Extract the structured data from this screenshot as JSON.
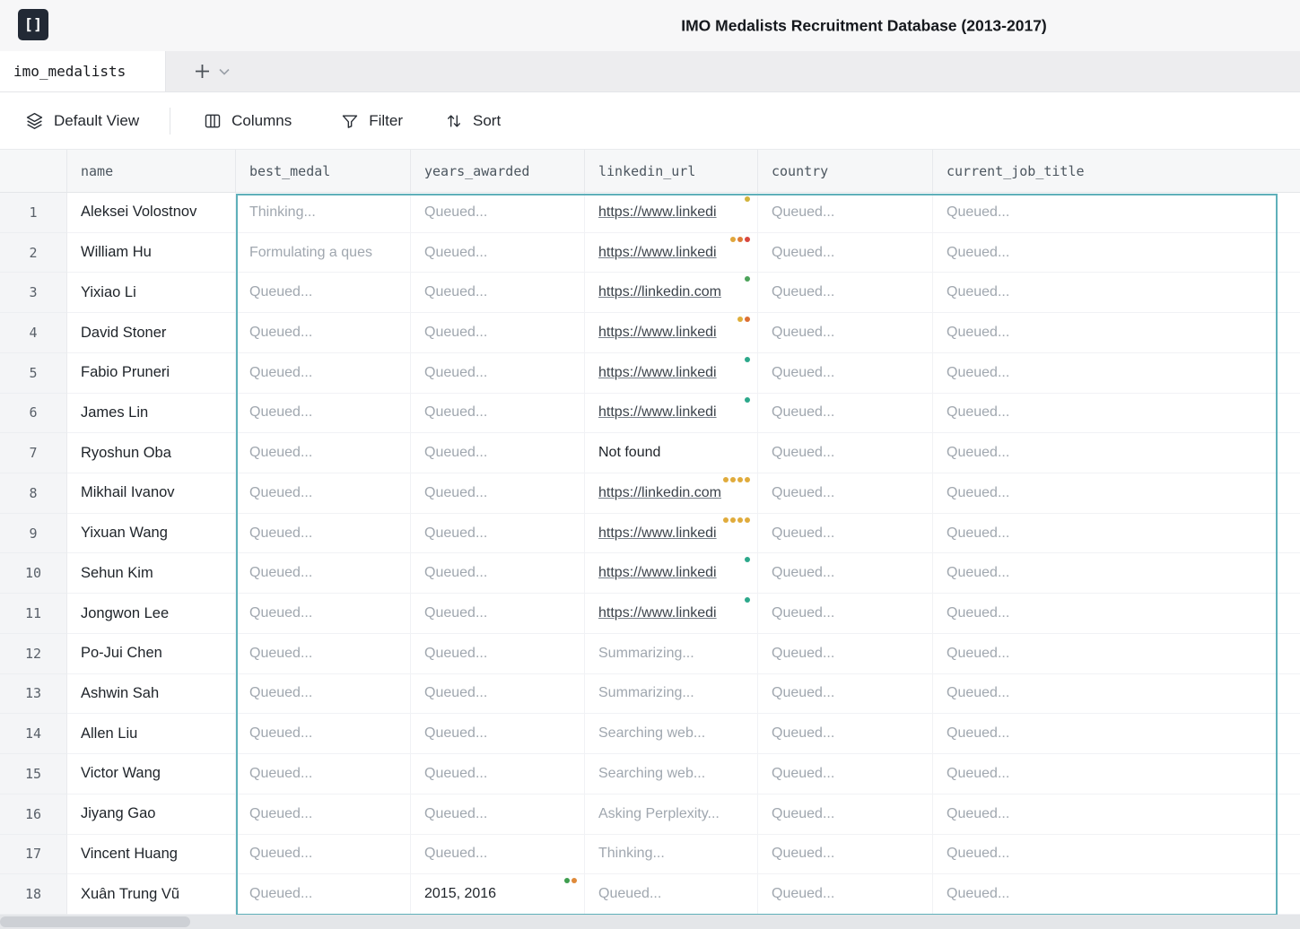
{
  "app": {
    "title": "IMO Medalists Recruitment Database (2013-2017)",
    "logo_glyph": "[]"
  },
  "tabs": {
    "active": "imo_medalists"
  },
  "toolbar": {
    "items": [
      {
        "label": "Default View",
        "icon": "layers-icon"
      },
      {
        "label": "Columns",
        "icon": "columns-icon"
      },
      {
        "label": "Filter",
        "icon": "filter-icon"
      },
      {
        "label": "Sort",
        "icon": "sort-icon"
      }
    ]
  },
  "colors": {
    "selection_border": "#5fb0ba",
    "dot_yellow": "#d2b33c",
    "dot_amber": "#e0a63c",
    "dot_orange": "#dd7d35",
    "dot_red": "#d8473f",
    "dot_green": "#4ca35a",
    "dot_teal": "#2ca88b"
  },
  "table": {
    "columns": [
      "name",
      "best_medal",
      "years_awarded",
      "linkedin_url",
      "country",
      "current_job_title"
    ],
    "rows": [
      {
        "num": "1",
        "name": "Aleksei Volostnov",
        "cells": {
          "best_medal": {
            "text": "Thinking...",
            "type": "status"
          },
          "years_awarded": {
            "text": "Queued...",
            "type": "status"
          },
          "linkedin_url": {
            "text": "https://www.linkedi",
            "type": "link",
            "dots": [
              "#d2b33c"
            ]
          },
          "country": {
            "text": "Queued...",
            "type": "status"
          },
          "current_job_title": {
            "text": "Queued...",
            "type": "status"
          }
        }
      },
      {
        "num": "2",
        "name": "William Hu",
        "cells": {
          "best_medal": {
            "text": "Formulating a ques",
            "type": "status"
          },
          "years_awarded": {
            "text": "Queued...",
            "type": "status"
          },
          "linkedin_url": {
            "text": "https://www.linkedi",
            "type": "link",
            "dots": [
              "#e0a63c",
              "#dd7d35",
              "#d8473f"
            ]
          },
          "country": {
            "text": "Queued...",
            "type": "status"
          },
          "current_job_title": {
            "text": "Queued...",
            "type": "status"
          }
        }
      },
      {
        "num": "3",
        "name": "Yixiao Li",
        "cells": {
          "best_medal": {
            "text": "Queued...",
            "type": "status"
          },
          "years_awarded": {
            "text": "Queued...",
            "type": "status"
          },
          "linkedin_url": {
            "text": "https://linkedin.com",
            "type": "link",
            "dots": [
              "#4ca35a"
            ]
          },
          "country": {
            "text": "Queued...",
            "type": "status"
          },
          "current_job_title": {
            "text": "Queued...",
            "type": "status"
          }
        }
      },
      {
        "num": "4",
        "name": "David Stoner",
        "cells": {
          "best_medal": {
            "text": "Queued...",
            "type": "status"
          },
          "years_awarded": {
            "text": "Queued...",
            "type": "status"
          },
          "linkedin_url": {
            "text": "https://www.linkedi",
            "type": "link",
            "dots": [
              "#dfae3a",
              "#dc6f33"
            ]
          },
          "country": {
            "text": "Queued...",
            "type": "status"
          },
          "current_job_title": {
            "text": "Queued...",
            "type": "status"
          }
        }
      },
      {
        "num": "5",
        "name": "Fabio Pruneri",
        "cells": {
          "best_medal": {
            "text": "Queued...",
            "type": "status"
          },
          "years_awarded": {
            "text": "Queued...",
            "type": "status"
          },
          "linkedin_url": {
            "text": "https://www.linkedi",
            "type": "link",
            "dots": [
              "#2ca88b"
            ]
          },
          "country": {
            "text": "Queued...",
            "type": "status"
          },
          "current_job_title": {
            "text": "Queued...",
            "type": "status"
          }
        }
      },
      {
        "num": "6",
        "name": "James Lin",
        "cells": {
          "best_medal": {
            "text": "Queued...",
            "type": "status"
          },
          "years_awarded": {
            "text": "Queued...",
            "type": "status"
          },
          "linkedin_url": {
            "text": "https://www.linkedi",
            "type": "link",
            "dots": [
              "#2ca88b"
            ]
          },
          "country": {
            "text": "Queued...",
            "type": "status"
          },
          "current_job_title": {
            "text": "Queued...",
            "type": "status"
          }
        }
      },
      {
        "num": "7",
        "name": "Ryoshun Oba",
        "cells": {
          "best_medal": {
            "text": "Queued...",
            "type": "status"
          },
          "years_awarded": {
            "text": "Queued...",
            "type": "status"
          },
          "linkedin_url": {
            "text": "Not found",
            "type": "plain"
          },
          "country": {
            "text": "Queued...",
            "type": "status"
          },
          "current_job_title": {
            "text": "Queued...",
            "type": "status"
          }
        }
      },
      {
        "num": "8",
        "name": "Mikhail Ivanov",
        "cells": {
          "best_medal": {
            "text": "Queued...",
            "type": "status"
          },
          "years_awarded": {
            "text": "Queued...",
            "type": "status"
          },
          "linkedin_url": {
            "text": "https://linkedin.com",
            "type": "link",
            "dots": [
              "#e0ab3c",
              "#e0ab3c",
              "#e0ab3c",
              "#e0ab3c"
            ]
          },
          "country": {
            "text": "Queued...",
            "type": "status"
          },
          "current_job_title": {
            "text": "Queued...",
            "type": "status"
          }
        }
      },
      {
        "num": "9",
        "name": "Yixuan Wang",
        "cells": {
          "best_medal": {
            "text": "Queued...",
            "type": "status"
          },
          "years_awarded": {
            "text": "Queued...",
            "type": "status"
          },
          "linkedin_url": {
            "text": "https://www.linkedi",
            "type": "link",
            "dots": [
              "#e0ab3c",
              "#e0ab3c",
              "#e0ab3c",
              "#e0ab3c"
            ]
          },
          "country": {
            "text": "Queued...",
            "type": "status"
          },
          "current_job_title": {
            "text": "Queued...",
            "type": "status"
          }
        }
      },
      {
        "num": "10",
        "name": "Sehun Kim",
        "cells": {
          "best_medal": {
            "text": "Queued...",
            "type": "status"
          },
          "years_awarded": {
            "text": "Queued...",
            "type": "status"
          },
          "linkedin_url": {
            "text": "https://www.linkedi",
            "type": "link",
            "dots": [
              "#2ca88b"
            ]
          },
          "country": {
            "text": "Queued...",
            "type": "status"
          },
          "current_job_title": {
            "text": "Queued...",
            "type": "status"
          }
        }
      },
      {
        "num": "11",
        "name": "Jongwon Lee",
        "cells": {
          "best_medal": {
            "text": "Queued...",
            "type": "status"
          },
          "years_awarded": {
            "text": "Queued...",
            "type": "status"
          },
          "linkedin_url": {
            "text": "https://www.linkedi",
            "type": "link",
            "dots": [
              "#2ca88b"
            ]
          },
          "country": {
            "text": "Queued...",
            "type": "status"
          },
          "current_job_title": {
            "text": "Queued...",
            "type": "status"
          }
        }
      },
      {
        "num": "12",
        "name": "Po-Jui Chen",
        "cells": {
          "best_medal": {
            "text": "Queued...",
            "type": "status"
          },
          "years_awarded": {
            "text": "Queued...",
            "type": "status"
          },
          "linkedin_url": {
            "text": "Summarizing...",
            "type": "status"
          },
          "country": {
            "text": "Queued...",
            "type": "status"
          },
          "current_job_title": {
            "text": "Queued...",
            "type": "status"
          }
        }
      },
      {
        "num": "13",
        "name": "Ashwin Sah",
        "cells": {
          "best_medal": {
            "text": "Queued...",
            "type": "status"
          },
          "years_awarded": {
            "text": "Queued...",
            "type": "status"
          },
          "linkedin_url": {
            "text": "Summarizing...",
            "type": "status"
          },
          "country": {
            "text": "Queued...",
            "type": "status"
          },
          "current_job_title": {
            "text": "Queued...",
            "type": "status"
          }
        }
      },
      {
        "num": "14",
        "name": "Allen Liu",
        "cells": {
          "best_medal": {
            "text": "Queued...",
            "type": "status"
          },
          "years_awarded": {
            "text": "Queued...",
            "type": "status"
          },
          "linkedin_url": {
            "text": "Searching web...",
            "type": "status"
          },
          "country": {
            "text": "Queued...",
            "type": "status"
          },
          "current_job_title": {
            "text": "Queued...",
            "type": "status"
          }
        }
      },
      {
        "num": "15",
        "name": "Victor Wang",
        "cells": {
          "best_medal": {
            "text": "Queued...",
            "type": "status"
          },
          "years_awarded": {
            "text": "Queued...",
            "type": "status"
          },
          "linkedin_url": {
            "text": "Searching web...",
            "type": "status"
          },
          "country": {
            "text": "Queued...",
            "type": "status"
          },
          "current_job_title": {
            "text": "Queued...",
            "type": "status"
          }
        }
      },
      {
        "num": "16",
        "name": "Jiyang Gao",
        "cells": {
          "best_medal": {
            "text": "Queued...",
            "type": "status"
          },
          "years_awarded": {
            "text": "Queued...",
            "type": "status"
          },
          "linkedin_url": {
            "text": "Asking Perplexity...",
            "type": "status"
          },
          "country": {
            "text": "Queued...",
            "type": "status"
          },
          "current_job_title": {
            "text": "Queued...",
            "type": "status"
          }
        }
      },
      {
        "num": "17",
        "name": "Vincent Huang",
        "cells": {
          "best_medal": {
            "text": "Queued...",
            "type": "status"
          },
          "years_awarded": {
            "text": "Queued...",
            "type": "status"
          },
          "linkedin_url": {
            "text": "Thinking...",
            "type": "status"
          },
          "country": {
            "text": "Queued...",
            "type": "status"
          },
          "current_job_title": {
            "text": "Queued...",
            "type": "status"
          }
        }
      },
      {
        "num": "18",
        "name": "Xuân Trung Vũ",
        "cells": {
          "best_medal": {
            "text": "Queued...",
            "type": "status"
          },
          "years_awarded": {
            "text": "2015, 2016",
            "type": "plain",
            "dots": [
              "#3f9e4f",
              "#df8a3a"
            ]
          },
          "linkedin_url": {
            "text": "Queued...",
            "type": "status"
          },
          "country": {
            "text": "Queued...",
            "type": "status"
          },
          "current_job_title": {
            "text": "Queued...",
            "type": "status"
          }
        }
      }
    ]
  }
}
